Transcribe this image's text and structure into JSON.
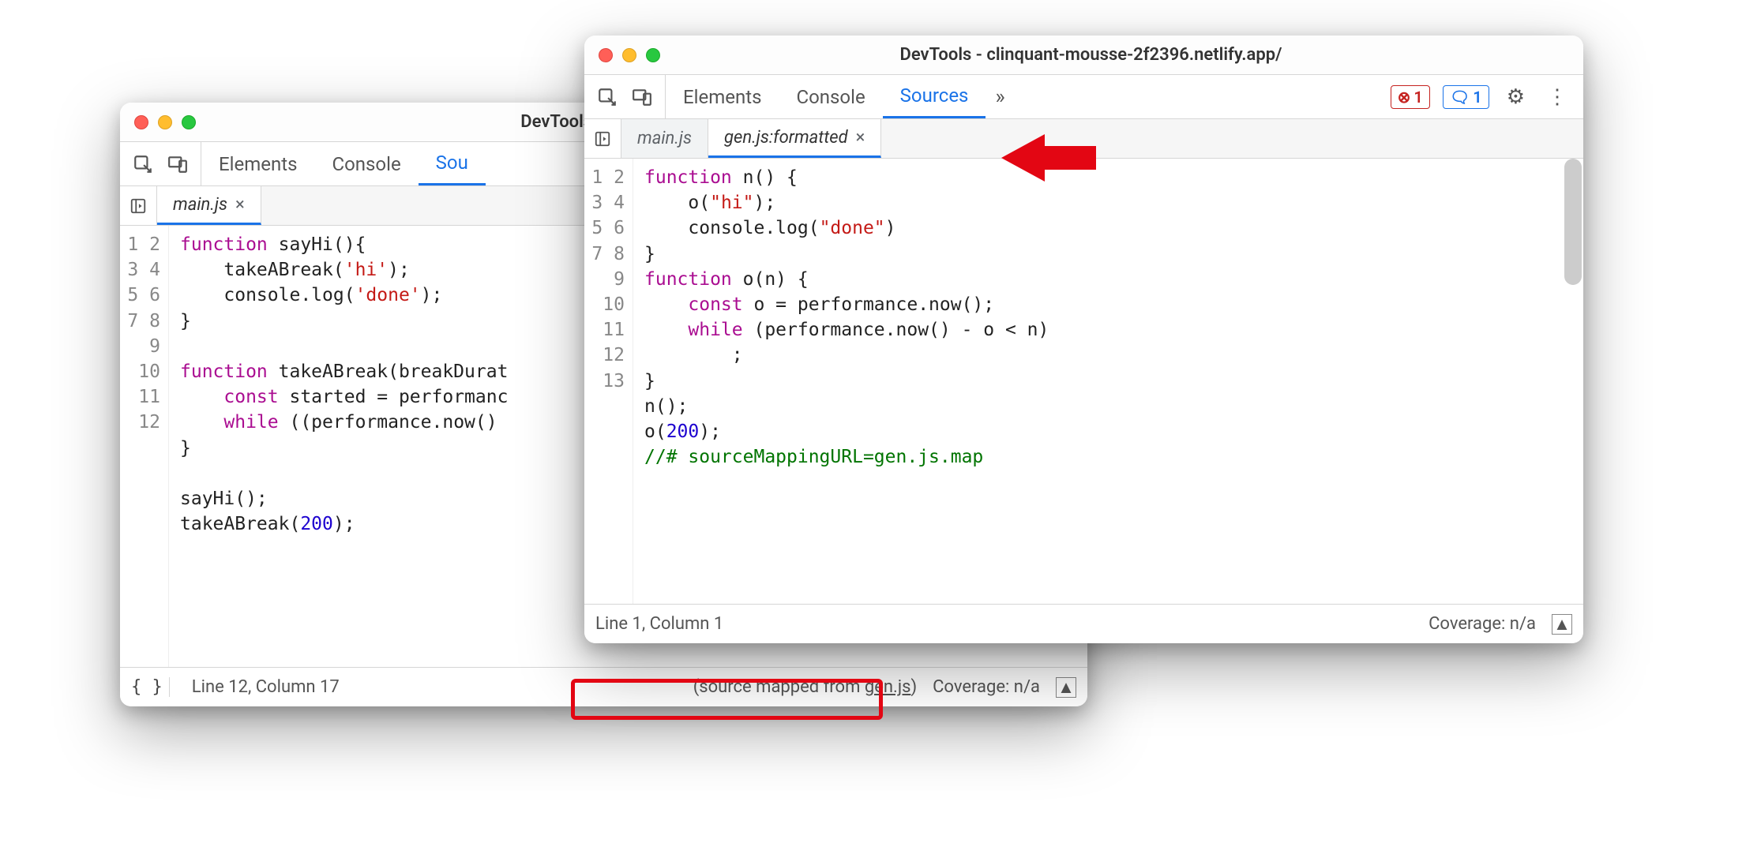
{
  "back": {
    "title": "DevTools - clinquant-m",
    "tabs": {
      "elements": "Elements",
      "console": "Console",
      "sources": "Sou"
    },
    "docTab": "main.js",
    "gutter": [
      "1",
      "2",
      "3",
      "4",
      "5",
      "6",
      "7",
      "8",
      "9",
      "10",
      "11",
      "12"
    ],
    "code": {
      "l1a": "function",
      "l1b": " sayHi(){",
      "l2a": "    takeABreak(",
      "l2b": "'hi'",
      "l2c": ");",
      "l3a": "    console.log(",
      "l3b": "'done'",
      "l3c": ");",
      "l4": "}",
      "l5": "",
      "l6a": "function",
      "l6b": " takeABreak(breakDurat",
      "l7a": "    ",
      "l7b": "const",
      "l7c": " started = performanc",
      "l8a": "    ",
      "l8b": "while",
      "l8c": " ((performance.now() ",
      "l9": "}",
      "l10": "",
      "l11": "sayHi();",
      "l12a": "takeABreak(",
      "l12b": "200",
      "l12c": ");"
    },
    "status": {
      "lineCol": "Line 12, Column 17",
      "sourceMapped": "(source mapped from ",
      "sourceMappedLink": "gen.js",
      "sourceMappedEnd": ")",
      "coverage": "Coverage: n/a"
    }
  },
  "front": {
    "title": "DevTools - clinquant-mousse-2f2396.netlify.app/",
    "tabs": {
      "elements": "Elements",
      "console": "Console",
      "sources": "Sources"
    },
    "errCount": "1",
    "msgCount": "1",
    "docTab1": "main.js",
    "docTab2": "gen.js:formatted",
    "gutter": [
      "1",
      "2",
      "3",
      "4",
      "5",
      "6",
      "7",
      "8",
      "9",
      "10",
      "11",
      "12",
      "13"
    ],
    "code": {
      "l1a": "function",
      "l1b": " n() {",
      "l2a": "    o(",
      "l2b": "\"hi\"",
      "l2c": ");",
      "l3a": "    console.log(",
      "l3b": "\"done\"",
      "l3c": ")",
      "l4": "}",
      "l5a": "function",
      "l5b": " o(n) {",
      "l6a": "    ",
      "l6b": "const",
      "l6c": " o = performance.now();",
      "l7a": "    ",
      "l7b": "while",
      "l7c": " (performance.now() - o < n)",
      "l8": "        ;",
      "l9": "}",
      "l10": "n();",
      "l11a": "o(",
      "l11b": "200",
      "l11c": ");",
      "l12": "//# sourceMappingURL=gen.js.map",
      "l13": ""
    },
    "status": {
      "lineCol": "Line 1, Column 1",
      "coverage": "Coverage: n/a"
    }
  }
}
